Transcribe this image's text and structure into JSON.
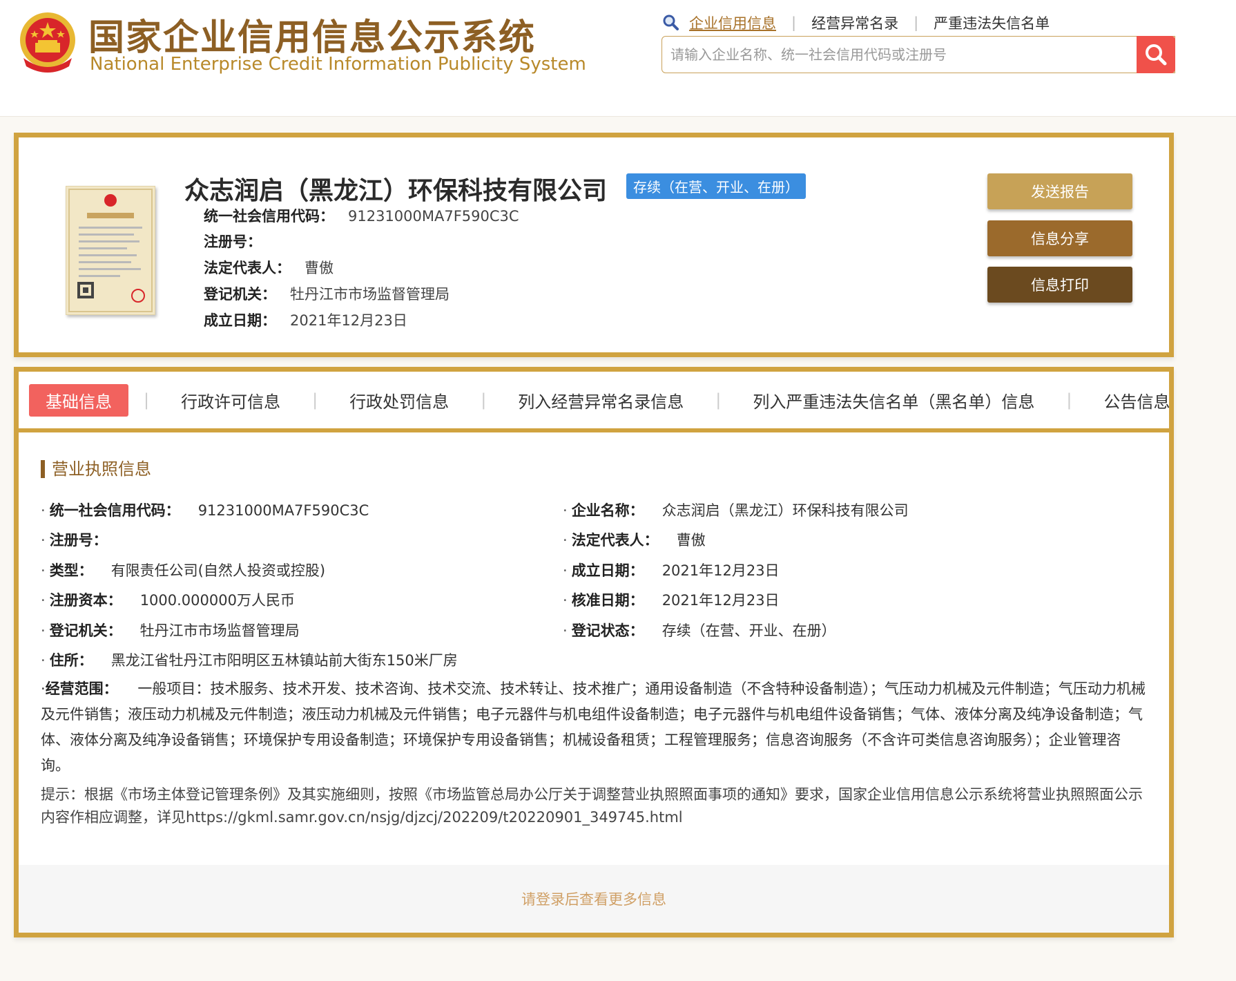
{
  "site": {
    "title": "国家企业信用信息公示系统",
    "subtitle": "National Enterprise Credit Information Publicity System"
  },
  "nav": {
    "links": [
      "企业信用信息",
      "经营异常名录",
      "严重违法失信名单"
    ]
  },
  "search": {
    "placeholder": "请输入企业名称、统一社会信用代码或注册号",
    "value": ""
  },
  "company": {
    "name": "众志润启（黑龙江）环保科技有限公司",
    "status": "存续（在营、开业、在册）",
    "fields": [
      {
        "label": "统一社会信用代码：",
        "value": "91231000MA7F590C3C"
      },
      {
        "label": "注册号：",
        "value": ""
      },
      {
        "label": "法定代表人：",
        "value": "曹傲"
      },
      {
        "label": "登记机关：",
        "value": "牡丹江市市场监督管理局"
      },
      {
        "label": "成立日期：",
        "value": "2021年12月23日"
      }
    ]
  },
  "actions": {
    "send": "发送报告",
    "share": "信息分享",
    "print": "信息打印"
  },
  "tabs": [
    "基础信息",
    "行政许可信息",
    "行政处罚信息",
    "列入经营异常名录信息",
    "列入严重违法失信名单（黑名单）信息",
    "公告信息"
  ],
  "license_section": {
    "title": "营业执照信息",
    "left": [
      {
        "label": "统一社会信用代码：",
        "value": "91231000MA7F590C3C"
      },
      {
        "label": "注册号：",
        "value": ""
      },
      {
        "label": "类型：",
        "value": "有限责任公司(自然人投资或控股)"
      },
      {
        "label": "注册资本：",
        "value": "1000.000000万人民币"
      },
      {
        "label": "登记机关：",
        "value": "牡丹江市市场监督管理局"
      },
      {
        "label": "住所：",
        "value": "黑龙江省牡丹江市阳明区五林镇站前大街东150米厂房"
      }
    ],
    "right": [
      {
        "label": "企业名称：",
        "value": "众志润启（黑龙江）环保科技有限公司"
      },
      {
        "label": "法定代表人：",
        "value": "曹傲"
      },
      {
        "label": "成立日期：",
        "value": "2021年12月23日"
      },
      {
        "label": "核准日期：",
        "value": "2021年12月23日"
      },
      {
        "label": "登记状态：",
        "value": "存续（在营、开业、在册）"
      }
    ],
    "scope_label": "经营范围：",
    "scope_value": "一般项目：技术服务、技术开发、技术咨询、技术交流、技术转让、技术推广；通用设备制造（不含特种设备制造）；气压动力机械及元件制造；气压动力机械及元件销售；液压动力机械及元件制造；液压动力机械及元件销售；电子元器件与机电组件设备制造；电子元器件与机电组件设备销售；气体、液体分离及纯净设备制造；气体、液体分离及纯净设备销售；环境保护专用设备制造；环境保护专用设备销售；机械设备租赁；工程管理服务；信息咨询服务（不含许可类信息咨询服务）；企业管理咨询。",
    "tip": "提示：根据《市场主体登记管理条例》及其实施细则，按照《市场监管总局办公厅关于调整营业执照照面事项的通知》要求，国家企业信用信息公示系统将营业执照照面公示内容作相应调整，详见https://gkml.samr.gov.cn/nsjg/djzcj/202209/t20220901_349745.html"
  },
  "footer": {
    "login_hint": "请登录后查看更多信息"
  },
  "colors": {
    "gold": "#d0a340",
    "brown": "#8d5f24",
    "tab_active": "#f2625e",
    "status_blue": "#3b8ee0",
    "search_red": "#f0514a"
  }
}
